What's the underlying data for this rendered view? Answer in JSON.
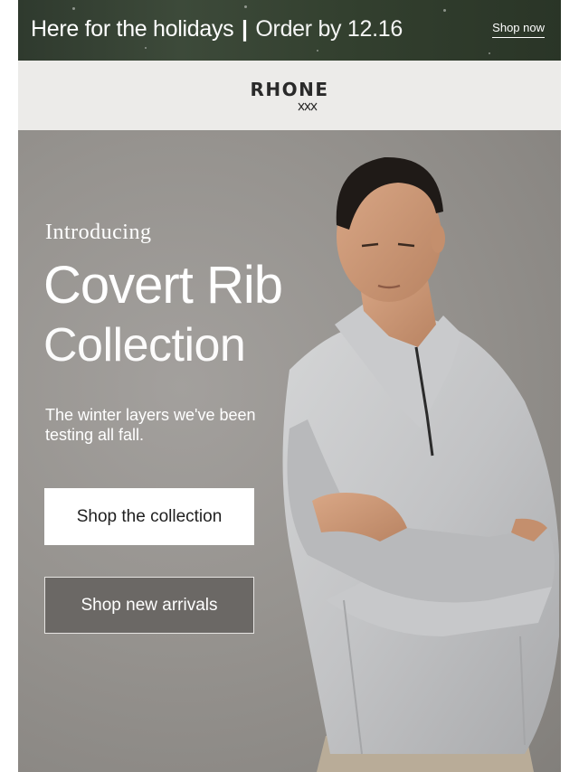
{
  "banner": {
    "headline": "Here for the holidays",
    "separator": "|",
    "deadline": "Order by 12.16",
    "link_label": "Shop now"
  },
  "header": {
    "logo_text": "RHONE"
  },
  "hero": {
    "eyebrow": "Introducing",
    "title_line1": "Covert Rib",
    "title_line2": "Collection",
    "subtitle": "The winter layers we've been testing all fall.",
    "primary_cta": "Shop the collection",
    "secondary_cta": "Shop new arrivals"
  },
  "colors": {
    "banner_bg": "#33402f",
    "logo_bar_bg": "#ecebe9",
    "hero_bg": "#96938f",
    "button_light": "#ffffff",
    "button_dark": "#6b6865"
  }
}
